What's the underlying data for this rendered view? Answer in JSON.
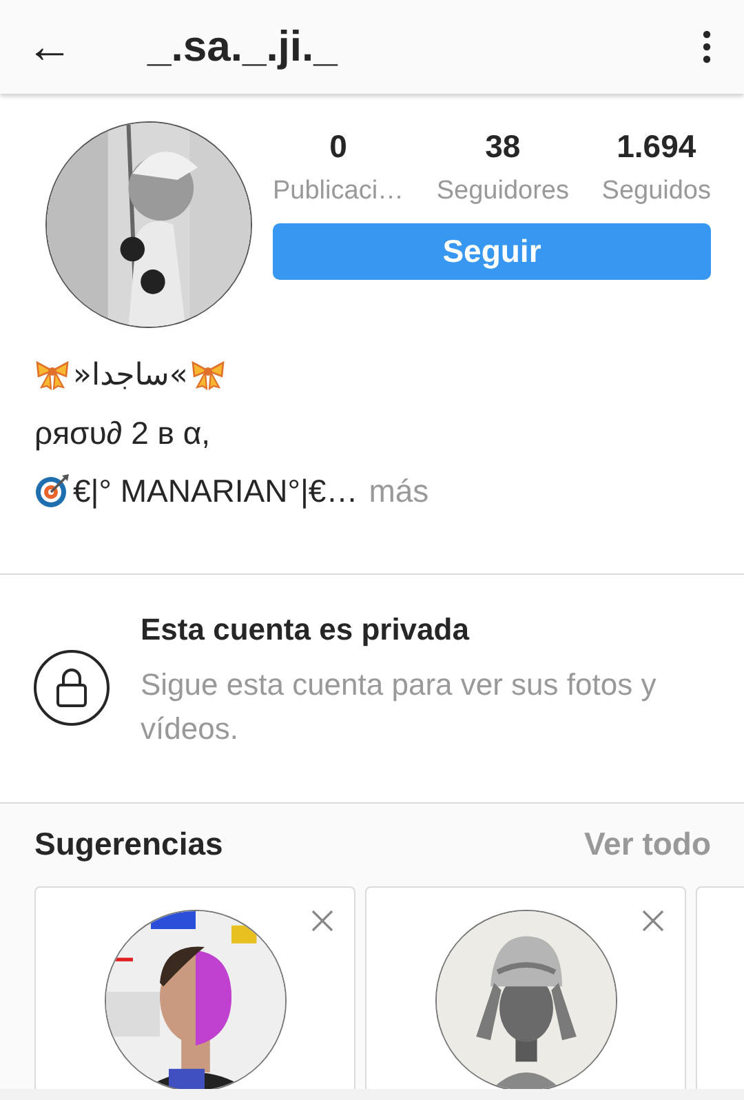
{
  "header": {
    "back_icon": "←",
    "title": "_.sa._.ji._"
  },
  "profile": {
    "stats": [
      {
        "value": "0",
        "label": "Publicaci…"
      },
      {
        "value": "38",
        "label": "Seguidores"
      },
      {
        "value": "1.694",
        "label": "Seguidos"
      }
    ],
    "follow_button": "Seguir"
  },
  "bio": {
    "lines": [
      {
        "kind": "ribboned",
        "text": "»ساجدا«"
      },
      {
        "kind": "plain",
        "text": "ρяσυ∂ 2 в α,"
      },
      {
        "kind": "target",
        "text": "€|° MANARIAN°|€…",
        "more": "más"
      }
    ]
  },
  "private_notice": {
    "title": "Esta cuenta es privada",
    "text": "Sigue esta cuenta para ver sus fotos y vídeos."
  },
  "suggestions": {
    "title": "Sugerencias",
    "see_all": "Ver todo",
    "cards": [
      {
        "kind": "picture"
      },
      {
        "kind": "picture"
      },
      {
        "kind": "cut"
      }
    ]
  }
}
